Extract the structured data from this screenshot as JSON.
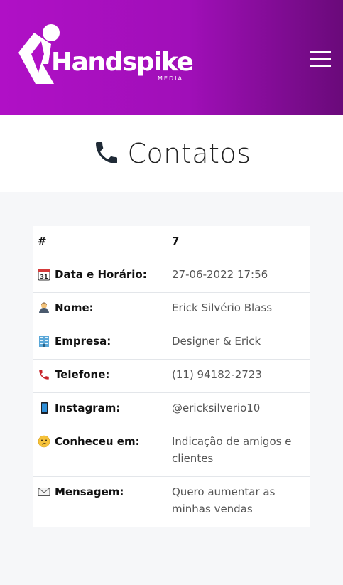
{
  "header": {
    "logo_text": "Handspike",
    "logo_sub": "MEDIA",
    "menu_icon": "hamburger-menu-icon"
  },
  "page": {
    "title": "Contatos",
    "title_icon": "phone-icon"
  },
  "contact": {
    "rows": [
      {
        "icon": "hash",
        "label": "#",
        "value": "7"
      },
      {
        "icon": "calendar-icon",
        "label": "Data e Horário:",
        "value": "27-06-2022 17:56"
      },
      {
        "icon": "person-icon",
        "label": "Nome:",
        "value": "Erick Silvério Blass"
      },
      {
        "icon": "building-icon",
        "label": "Empresa:",
        "value": "Designer & Erick"
      },
      {
        "icon": "telephone-icon",
        "label": "Telefone:",
        "value": "(11) 94182-2723"
      },
      {
        "icon": "mobile-phone-icon",
        "label": "Instagram:",
        "value": "@ericksilverio10"
      },
      {
        "icon": "confused-face-icon",
        "label": "Conheceu em:",
        "value": "Indicação de amigos e clientes"
      },
      {
        "icon": "envelope-icon",
        "label": "Mensagem:",
        "value": "Quero aumentar as minhas vendas"
      }
    ]
  },
  "colors": {
    "header_gradient_start": "#b010c6",
    "header_gradient_end": "#6a0a7a",
    "page_bg": "#f6f7f9"
  }
}
